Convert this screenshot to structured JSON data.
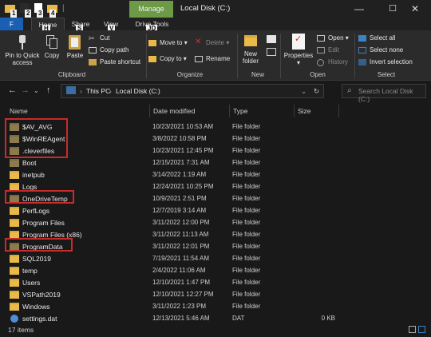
{
  "window": {
    "title": "Local Disk (C:)",
    "manage_tab": "Manage",
    "minimize": "—",
    "maximize": "☐",
    "close": "✕"
  },
  "qat_badges": [
    "1",
    "2",
    "3",
    "4"
  ],
  "tabs": {
    "file": "F",
    "home": "Home",
    "home_key": "H",
    "share": "Share",
    "share_key": "S",
    "view": "View",
    "view_key": "V",
    "drive_tools": "Drive Tools",
    "drive_tools_key": "JD"
  },
  "ribbon": {
    "clipboard": {
      "label": "Clipboard",
      "pin": "Pin to Quick access",
      "copy": "Copy",
      "paste": "Paste",
      "cut": "Cut",
      "copy_path": "Copy path",
      "paste_shortcut": "Paste shortcut"
    },
    "organize": {
      "label": "Organize",
      "move_to": "Move to",
      "copy_to": "Copy to",
      "delete": "Delete",
      "rename": "Rename"
    },
    "new": {
      "label": "New",
      "new_folder": "New folder"
    },
    "open": {
      "label": "Open",
      "properties": "Properties",
      "open": "Open",
      "edit": "Edit",
      "history": "History"
    },
    "select": {
      "label": "Select",
      "select_all": "Select all",
      "select_none": "Select none",
      "invert_selection": "Invert selection"
    }
  },
  "address": {
    "crumb1": "This PC",
    "crumb2": "Local Disk (C:)",
    "search_placeholder": "Search Local Disk (C:)"
  },
  "columns": {
    "name": "Name",
    "date": "Date modified",
    "type": "Type",
    "size": "Size"
  },
  "files": [
    {
      "name": "$AV_AVG",
      "date": "10/23/2021 10:53 AM",
      "type": "File folder",
      "size": "",
      "icon": "folder-hidden"
    },
    {
      "name": "$WinREAgent",
      "date": "3/8/2022 10:58 PM",
      "type": "File folder",
      "size": "",
      "icon": "folder-hidden"
    },
    {
      "name": ".cleverfiles",
      "date": "10/23/2021 12:45 PM",
      "type": "File folder",
      "size": "",
      "icon": "folder-hidden"
    },
    {
      "name": "Boot",
      "date": "12/15/2021 7:31 AM",
      "type": "File folder",
      "size": "",
      "icon": "folder-hidden"
    },
    {
      "name": "inetpub",
      "date": "3/14/2022 1:19 AM",
      "type": "File folder",
      "size": "",
      "icon": "folder"
    },
    {
      "name": "Logs",
      "date": "12/24/2021 10:25 PM",
      "type": "File folder",
      "size": "",
      "icon": "folder"
    },
    {
      "name": "OneDriveTemp",
      "date": "10/9/2021 2:51 PM",
      "type": "File folder",
      "size": "",
      "icon": "folder-hidden"
    },
    {
      "name": "PerfLogs",
      "date": "12/7/2019 3:14 AM",
      "type": "File folder",
      "size": "",
      "icon": "folder"
    },
    {
      "name": "Program Files",
      "date": "3/11/2022 12:00 PM",
      "type": "File folder",
      "size": "",
      "icon": "folder"
    },
    {
      "name": "Program Files (x86)",
      "date": "3/11/2022 11:13 AM",
      "type": "File folder",
      "size": "",
      "icon": "folder"
    },
    {
      "name": "ProgramData",
      "date": "3/11/2022 12:01 PM",
      "type": "File folder",
      "size": "",
      "icon": "folder-hidden"
    },
    {
      "name": "SQL2019",
      "date": "7/19/2021 11:54 AM",
      "type": "File folder",
      "size": "",
      "icon": "folder"
    },
    {
      "name": "temp",
      "date": "2/4/2022 11:06 AM",
      "type": "File folder",
      "size": "",
      "icon": "folder"
    },
    {
      "name": "Users",
      "date": "12/10/2021 1:47 PM",
      "type": "File folder",
      "size": "",
      "icon": "folder"
    },
    {
      "name": "VSPath2019",
      "date": "12/10/2021 12:27 PM",
      "type": "File folder",
      "size": "",
      "icon": "folder"
    },
    {
      "name": "Windows",
      "date": "3/11/2022 1:23 PM",
      "type": "File folder",
      "size": "",
      "icon": "folder"
    },
    {
      "name": "settings.dat",
      "date": "12/13/2021 5:46 AM",
      "type": "DAT",
      "size": "0 KB",
      "icon": "dat-file"
    }
  ],
  "status": {
    "item_count": "17 items"
  },
  "colors": {
    "file_tab": "#1a5fb4",
    "manage_tab": "#6c9a46",
    "highlight": "#c92a2a"
  }
}
